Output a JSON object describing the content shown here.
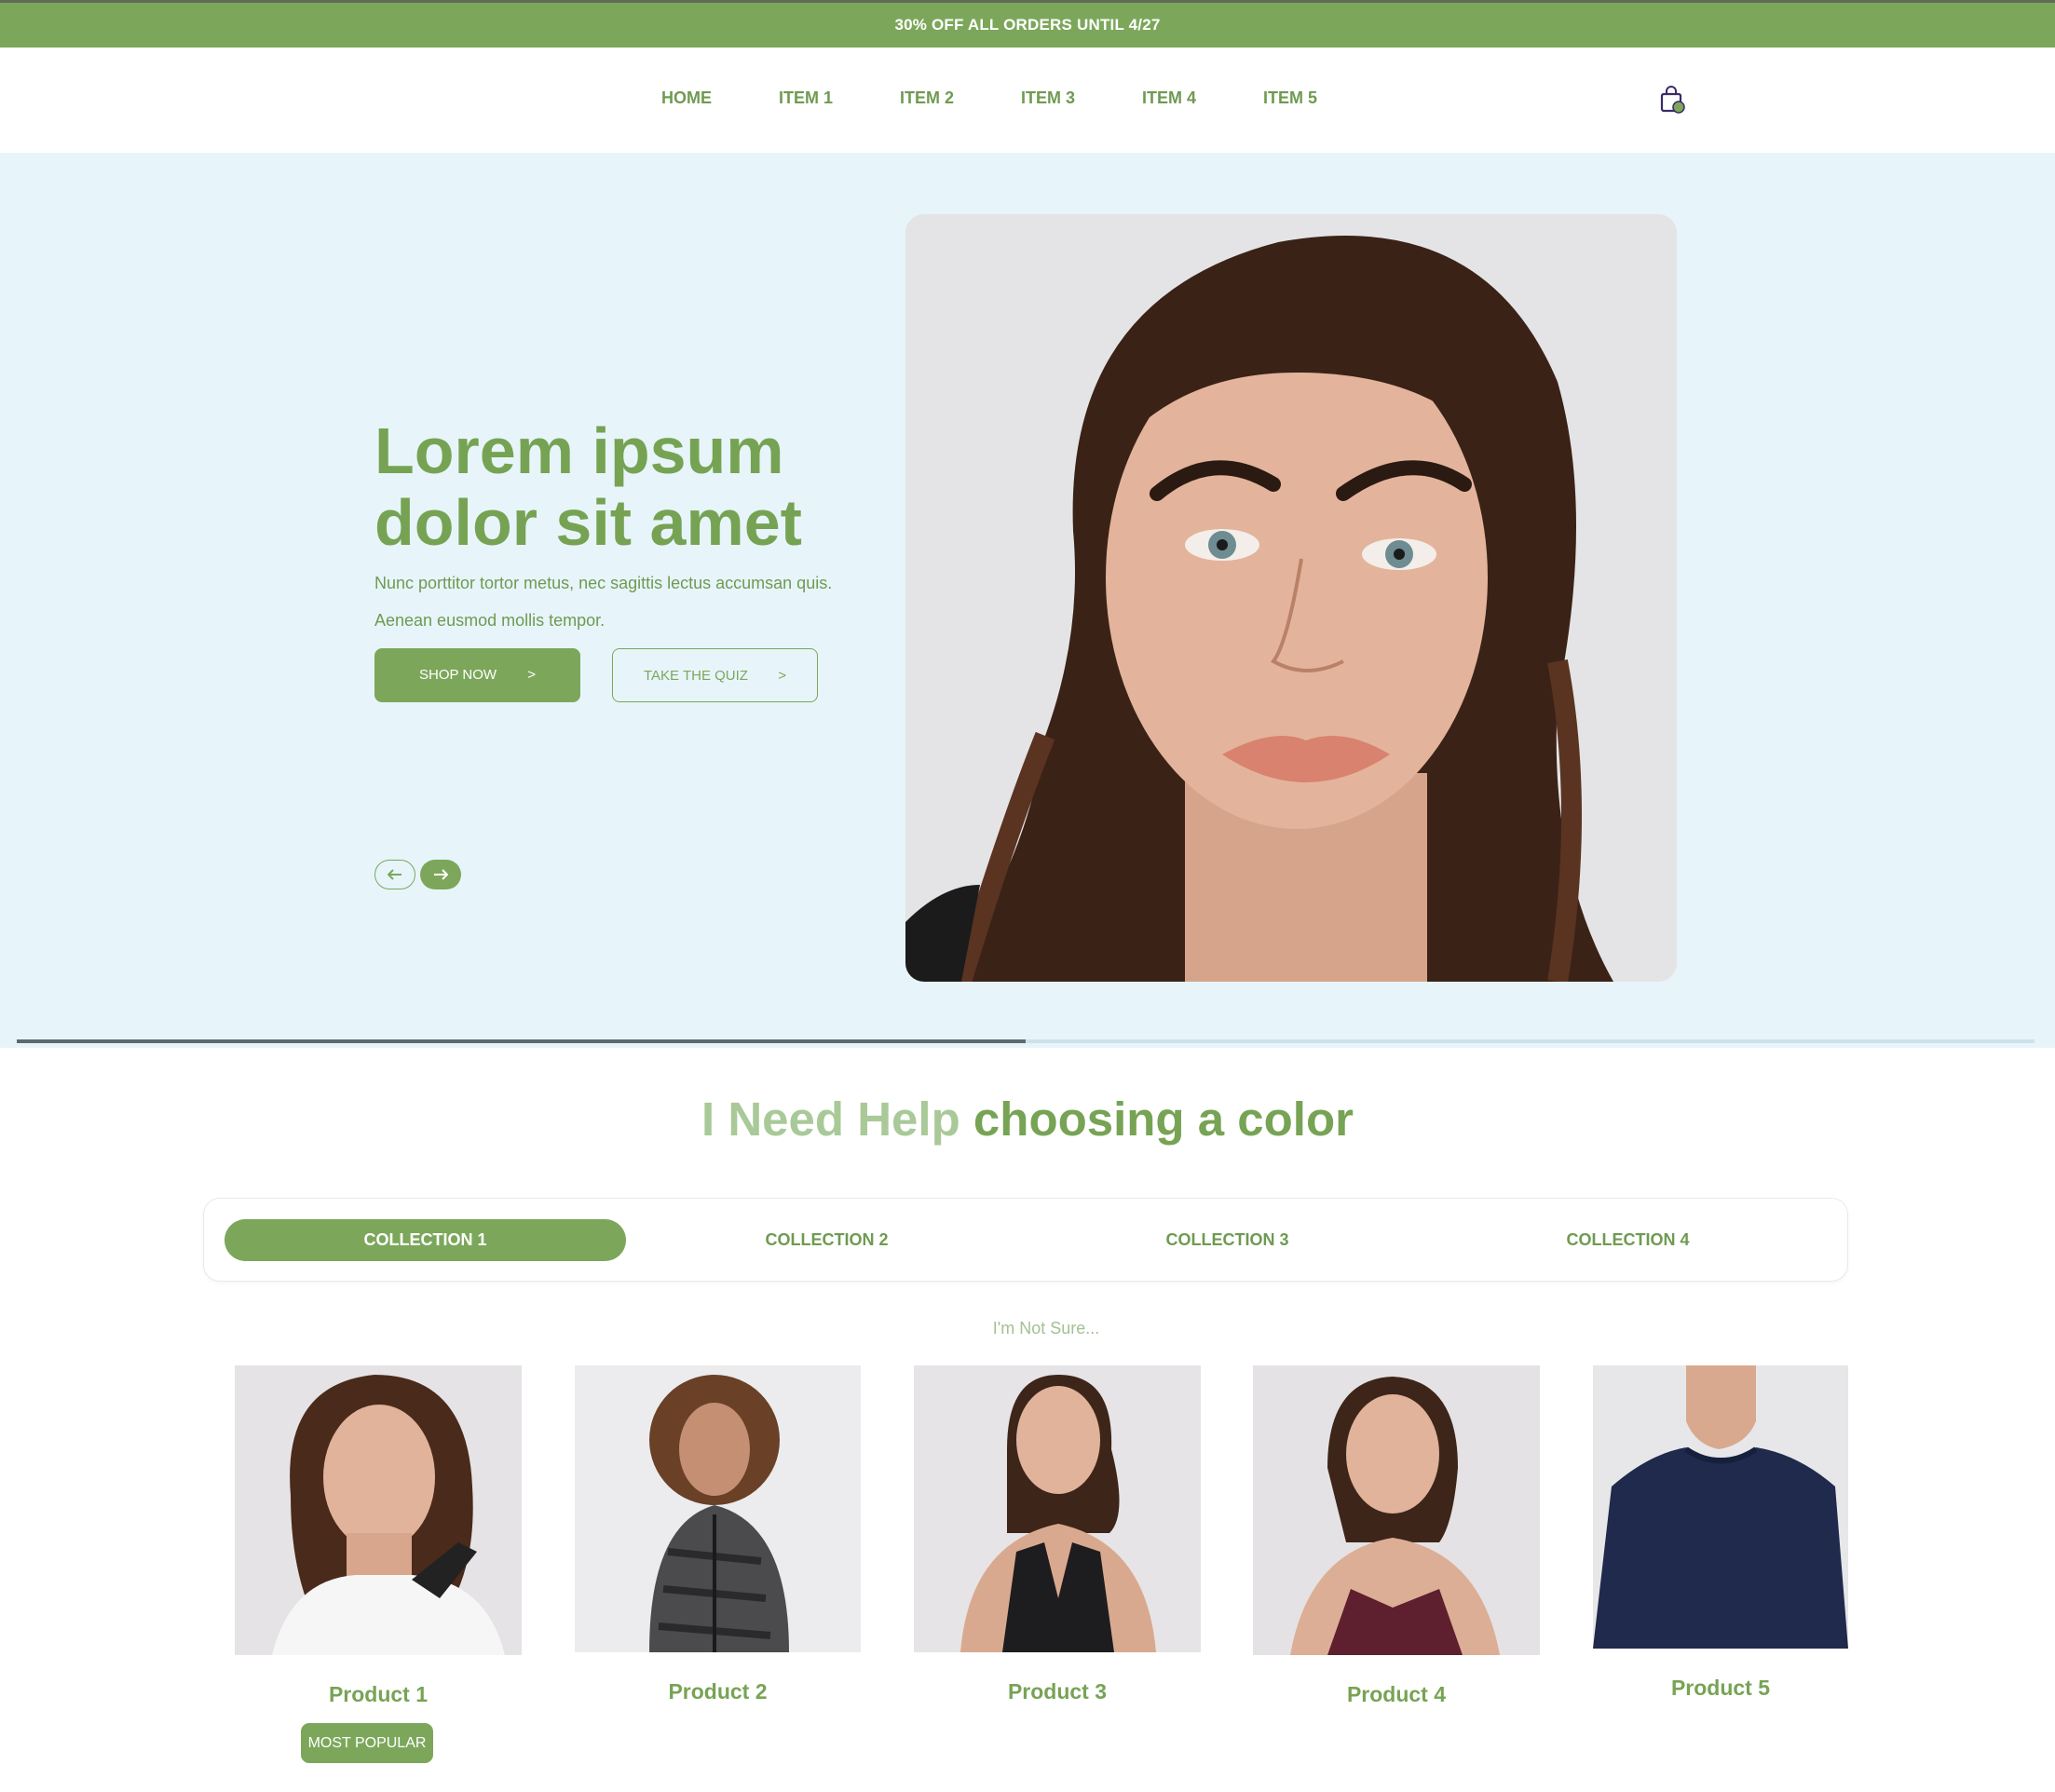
{
  "announcement": {
    "text": "30% OFF ALL ORDERS UNTIL 4/27"
  },
  "nav": {
    "items": [
      {
        "label": "HOME"
      },
      {
        "label": "ITEM 1"
      },
      {
        "label": "ITEM 2"
      },
      {
        "label": "ITEM 3"
      },
      {
        "label": "ITEM 4"
      },
      {
        "label": "ITEM 5"
      }
    ],
    "cart_icon": "shopping-bag-icon"
  },
  "hero": {
    "title_line1": "Lorem ipsum",
    "title_line2": "dolor sit amet",
    "subtitle_line1": "Nunc porttitor tortor metus, nec sagittis lectus accumsan quis.",
    "subtitle_line2": "Aenean eusmod mollis tempor.",
    "primary_button": {
      "label": "SHOP NOW",
      "arrow": ">"
    },
    "secondary_button": {
      "label": "TAKE THE QUIZ",
      "arrow": ">"
    },
    "prev_icon": "arrow-left-icon",
    "next_icon": "arrow-right-icon",
    "slide_progress": 0.5
  },
  "help": {
    "title_light": "I Need Help",
    "title_dark": "choosing a color",
    "tabs": [
      {
        "label": "COLLECTION 1",
        "active": true
      },
      {
        "label": "COLLECTION 2",
        "active": false
      },
      {
        "label": "COLLECTION 3",
        "active": false
      },
      {
        "label": "COLLECTION 4",
        "active": false
      }
    ],
    "not_sure": "I'm Not Sure...",
    "products": [
      {
        "name": "Product 1",
        "badge": "MOST POPULAR"
      },
      {
        "name": "Product 2"
      },
      {
        "name": "Product 3"
      },
      {
        "name": "Product 4"
      },
      {
        "name": "Product 5"
      }
    ]
  },
  "colors": {
    "brand_green": "#7ca75b",
    "light_green": "#a9c998",
    "hero_bg": "#e7f5fa"
  }
}
